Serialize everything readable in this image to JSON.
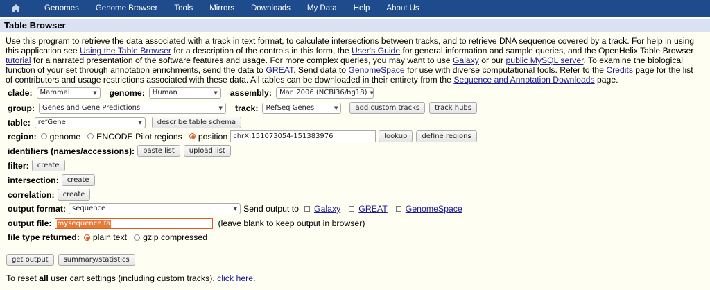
{
  "nav": {
    "items": [
      "Genomes",
      "Genome Browser",
      "Tools",
      "Mirrors",
      "Downloads",
      "My Data",
      "Help",
      "About Us"
    ]
  },
  "title": "Table Browser",
  "intro": {
    "p1": "Use this program to retrieve the data associated with a track in text format, to calculate intersections between tracks, and to retrieve DNA sequence covered by a track. For help in using this application see ",
    "link_using": "Using the Table Browser",
    "p2": " for a description of the controls in this form, the ",
    "link_guide": "User's Guide",
    "p3": " for general information and sample queries, and the OpenHelix Table Browser ",
    "link_tutorial": "tutorial",
    "p4": " for a narrated presentation of the software features and usage. For more complex queries, you may want to use ",
    "link_galaxy": "Galaxy",
    "p5": " or our ",
    "link_mysql": "public MySQL server",
    "p6": ". To examine the biological function of your set through annotation enrichments, send the data to ",
    "link_great": "GREAT",
    "p7": ". Send data to ",
    "link_genomespace": "GenomeSpace",
    "p8": " for use with diverse computational tools. Refer to the ",
    "link_credits": "Credits",
    "p9": " page for the list of contributors and usage restrictions associated with these data. All tables can be downloaded in their entirety from the ",
    "link_downloads": "Sequence and Annotation Downloads",
    "p10": " page."
  },
  "form": {
    "clade_label": "clade:",
    "clade_value": "Mammal",
    "genome_label": "genome:",
    "genome_value": "Human",
    "assembly_label": "assembly:",
    "assembly_value": "Mar. 2006 (NCBI36/hg18)",
    "group_label": "group:",
    "group_value": "Genes and Gene Predictions",
    "track_label": "track:",
    "track_value": "RefSeq Genes",
    "add_custom_tracks": "add custom tracks",
    "track_hubs": "track hubs",
    "table_label": "table:",
    "table_value": "refGene",
    "describe_schema": "describe table schema",
    "region_label": "region:",
    "region_genome": "genome",
    "region_encode": "ENCODE Pilot regions",
    "region_position": "position",
    "position_value": "chrX:151073054-151383976",
    "lookup": "lookup",
    "define_regions": "define regions",
    "identifiers_label": "identifiers (names/accessions):",
    "paste_list": "paste list",
    "upload_list": "upload list",
    "filter_label": "filter:",
    "filter_create": "create",
    "intersection_label": "intersection:",
    "intersection_create": "create",
    "correlation_label": "correlation:",
    "correlation_create": "create",
    "output_format_label": "output format:",
    "output_format_value": "sequence",
    "send_output_to": "Send output to",
    "send_galaxy": "Galaxy",
    "send_great": "GREAT",
    "send_genomespace": "GenomeSpace",
    "output_file_label": "output file:",
    "output_file_value": "mysequence.fa",
    "output_file_hint": "(leave blank to keep output in browser)",
    "file_type_label": "file type returned:",
    "file_plain": "plain text",
    "file_gzip": "gzip compressed",
    "get_output": "get output",
    "summary_stats": "summary/statistics"
  },
  "footer": {
    "pre": "To reset ",
    "bold": "all",
    "mid": " user cart settings (including custom tracks), ",
    "link": "click here",
    "post": "."
  },
  "colors": {
    "nav_bg": "#1d4b8b",
    "title_bg": "#d9e1f2",
    "page_bg": "#fffef3",
    "link": "#1a1a99"
  }
}
